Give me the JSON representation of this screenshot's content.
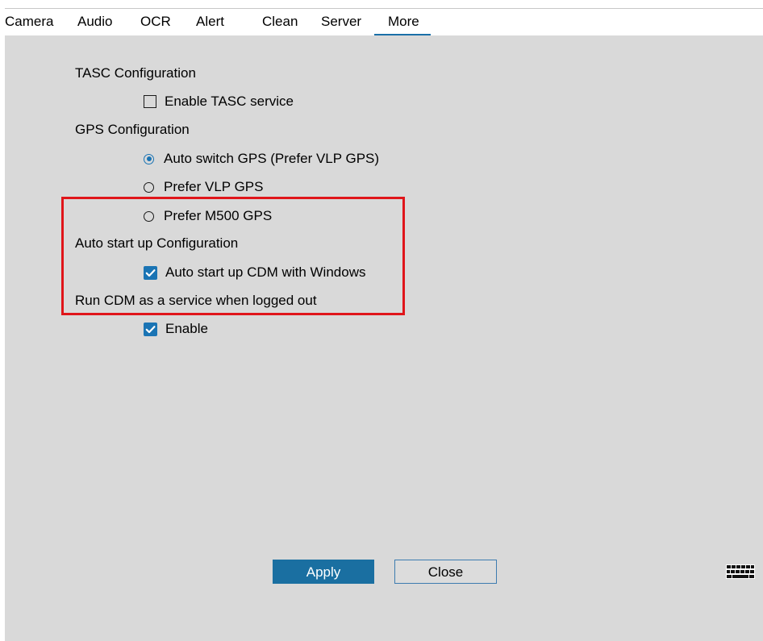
{
  "tabs": [
    {
      "label": "Camera"
    },
    {
      "label": "Audio"
    },
    {
      "label": "OCR"
    },
    {
      "label": "Alert"
    },
    {
      "label": "Clean"
    },
    {
      "label": "Server"
    },
    {
      "label": "More",
      "active": true
    }
  ],
  "tasc": {
    "heading": "TASC Configuration",
    "enable_label": "Enable TASC service",
    "enable_checked": false
  },
  "gps": {
    "heading": "GPS Configuration",
    "options": [
      {
        "label": "Auto switch GPS (Prefer VLP GPS)",
        "selected": true
      },
      {
        "label": "Prefer VLP GPS",
        "selected": false
      },
      {
        "label": "Prefer M500 GPS",
        "selected": false
      }
    ]
  },
  "autostart": {
    "heading": "Auto start up Configuration",
    "option_label": "Auto start up CDM with Windows",
    "option_checked": true
  },
  "service": {
    "heading": "Run CDM as a service when logged out",
    "enable_label": "Enable",
    "enable_checked": true
  },
  "buttons": {
    "apply": "Apply",
    "close": "Close"
  },
  "icons": {
    "keyboard": "keyboard-icon",
    "check": "checkmark-icon"
  },
  "colors": {
    "accent": "#1a74b4",
    "apply_bg": "#1a6fa1",
    "highlight": "#e0151a",
    "panel_bg": "#d9d9d9"
  }
}
